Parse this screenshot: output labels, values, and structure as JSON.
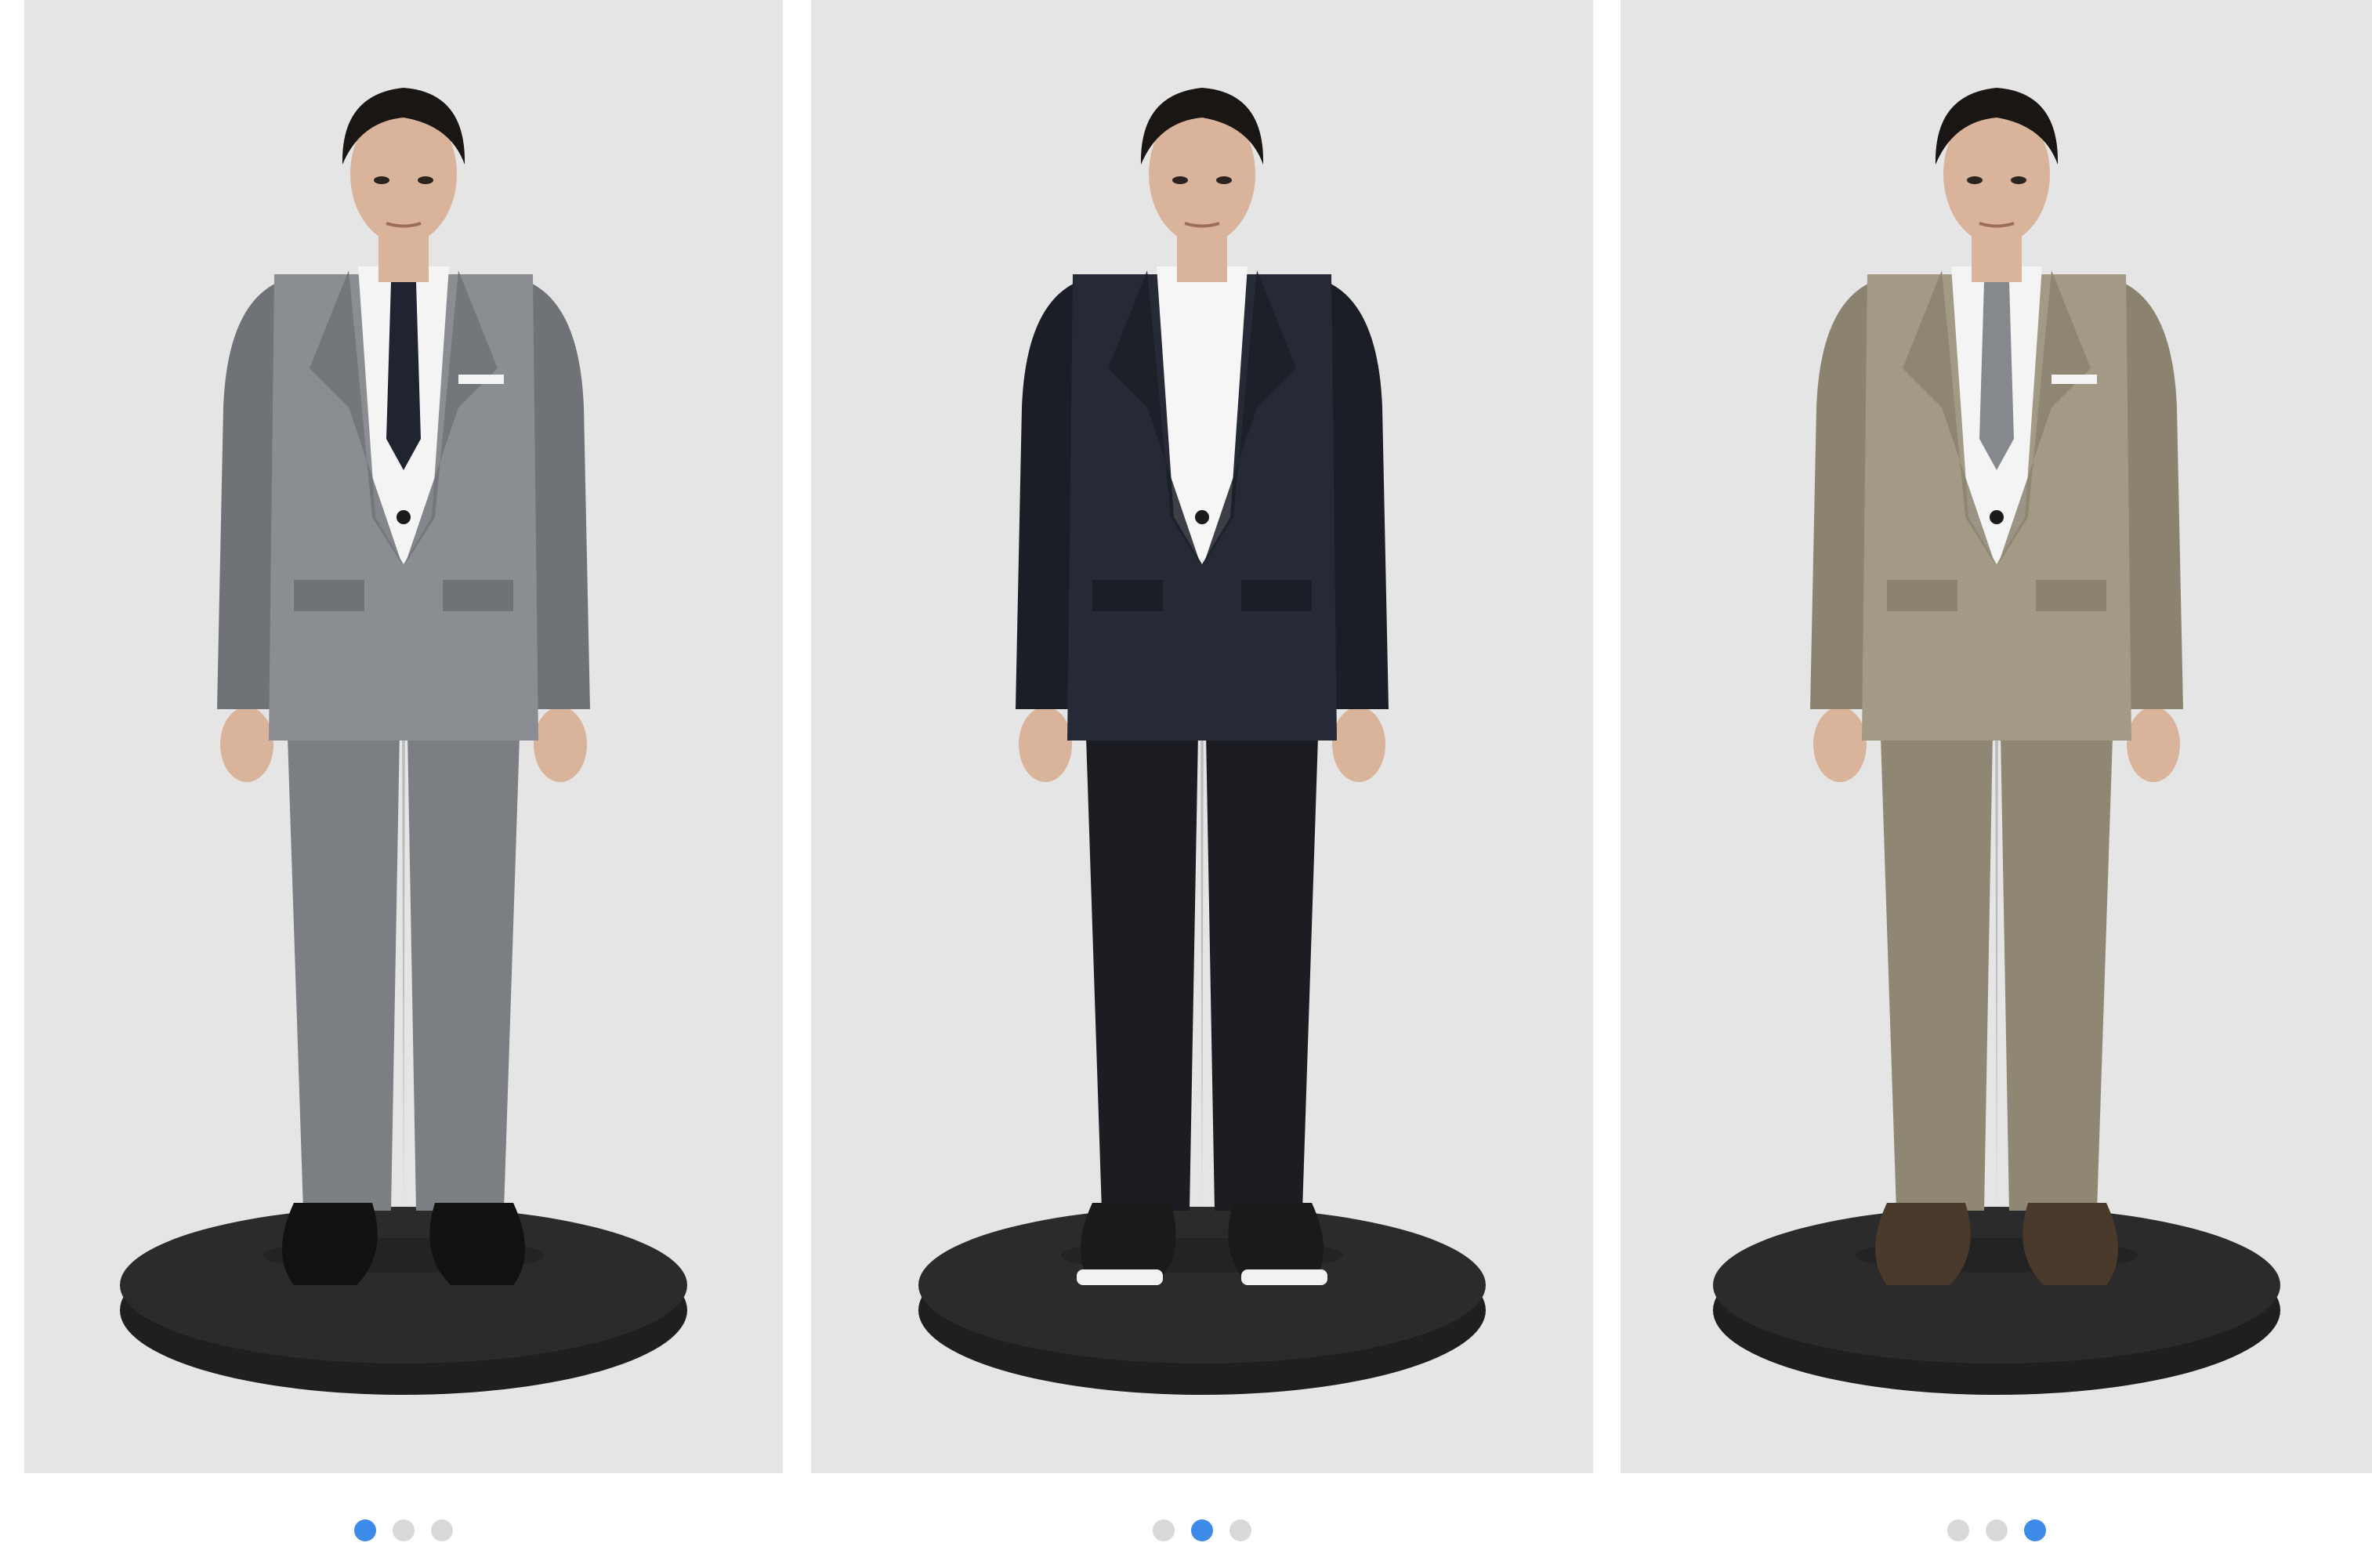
{
  "carousel": {
    "cards": [
      {
        "active_index": 0,
        "slide_count": 3,
        "photo": {
          "icon": "model-grey-check-suit-photo",
          "jacket": "#8a8d92",
          "jacket_shade": "#6f7277",
          "trousers": "#7b7e83",
          "shirt": "#f4f4f4",
          "tie": "#1f2430",
          "shoes": "#111111",
          "inner": "shirt-and-tie",
          "pocket_square": true
        }
      },
      {
        "active_index": 1,
        "slide_count": 3,
        "photo": {
          "icon": "model-navy-jacket-tee-photo",
          "jacket": "#262a36",
          "jacket_shade": "#1b1e27",
          "trousers": "#1c1d22",
          "shirt": "#f6f6f6",
          "tie": "none",
          "shoes": "#1a1a1a",
          "inner": "tshirt",
          "pocket_square": false
        }
      },
      {
        "active_index": 2,
        "slide_count": 3,
        "photo": {
          "icon": "model-khaki-suit-photo",
          "jacket": "#a39a86",
          "jacket_shade": "#8b8370",
          "trousers": "#8f8674",
          "shirt": "#f4f4f4",
          "tie": "#85888d",
          "shoes": "#4a3a2c",
          "inner": "shirt-and-tie",
          "pocket_square": true
        }
      }
    ],
    "colors": {
      "indicator_active": "#3d8ae8",
      "indicator_inactive": "#d9d9d9",
      "backdrop": "#e5e5e6",
      "pedestal": "#2b2b2c",
      "skin": "#d9b49a",
      "hair": "#1a1614"
    }
  }
}
